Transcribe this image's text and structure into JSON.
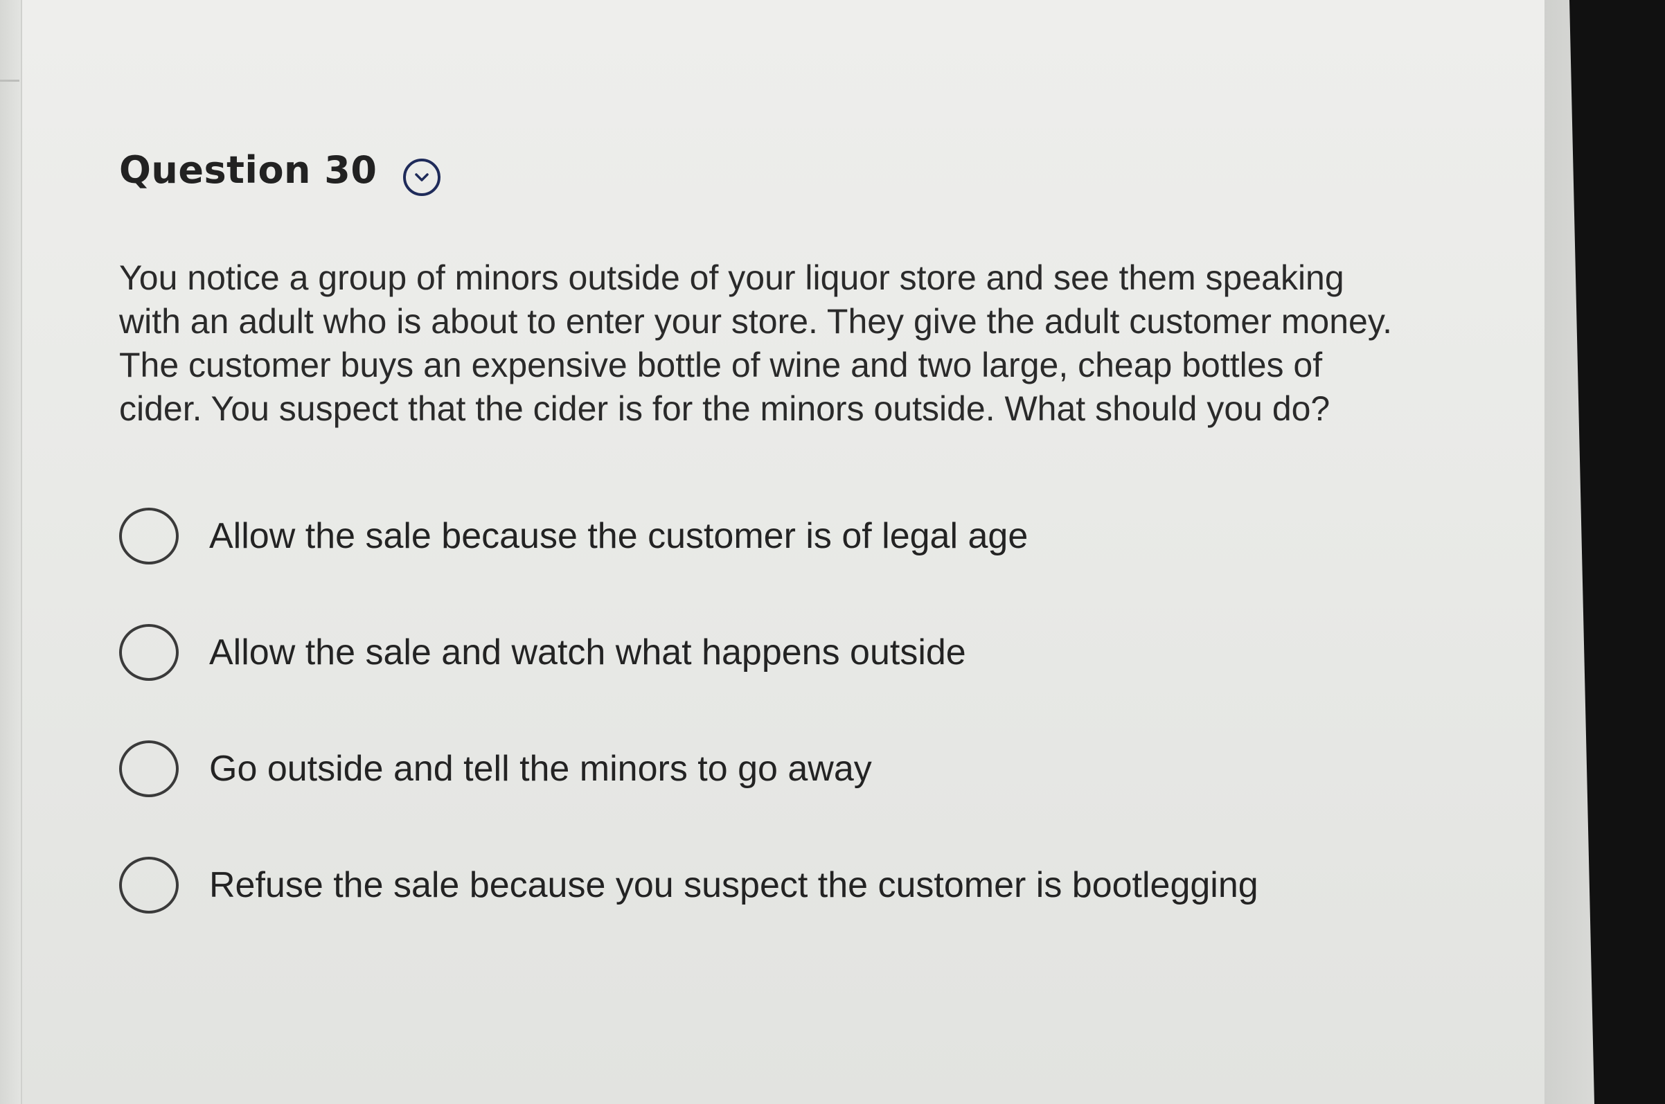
{
  "question": {
    "title": "Question 30",
    "toggle_icon": "chevron-down-icon",
    "text": "You notice a group of minors outside of your liquor store and see them speaking with an adult who is about to enter your store. They give the adult customer money. The customer buys an expensive bottle of wine and two large, cheap bottles of cider. You suspect that the cider is for the minors outside. What should you do?"
  },
  "options": [
    {
      "label": "Allow the sale because the customer is of legal age",
      "selected": false
    },
    {
      "label": "Allow the sale and watch what happens outside",
      "selected": false
    },
    {
      "label": "Go outside and tell the minors to go away",
      "selected": false
    },
    {
      "label": "Refuse the sale because you suspect the customer is bootlegging",
      "selected": false
    }
  ],
  "colors": {
    "page_background": "#eaebe8",
    "accent_icon": "#1f2b5a",
    "text": "#2a2a2a",
    "bezel": "#111111"
  }
}
